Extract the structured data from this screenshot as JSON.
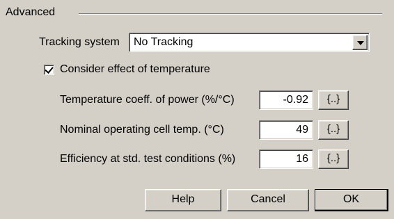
{
  "group": {
    "title": "Advanced"
  },
  "tracking": {
    "label": "Tracking system",
    "value": "No Tracking"
  },
  "temperature": {
    "checkbox_label": "Consider effect of temperature",
    "checked": true,
    "rows": [
      {
        "label": "Temperature coeff. of power (%/°C)",
        "value": "-0.92",
        "button": "{..}"
      },
      {
        "label": "Nominal operating cell temp. (°C)",
        "value": "49",
        "button": "{..}"
      },
      {
        "label": "Efficiency at std. test conditions (%)",
        "value": "16",
        "button": "{..}"
      }
    ]
  },
  "buttons": {
    "help": "Help",
    "cancel": "Cancel",
    "ok": "OK"
  }
}
